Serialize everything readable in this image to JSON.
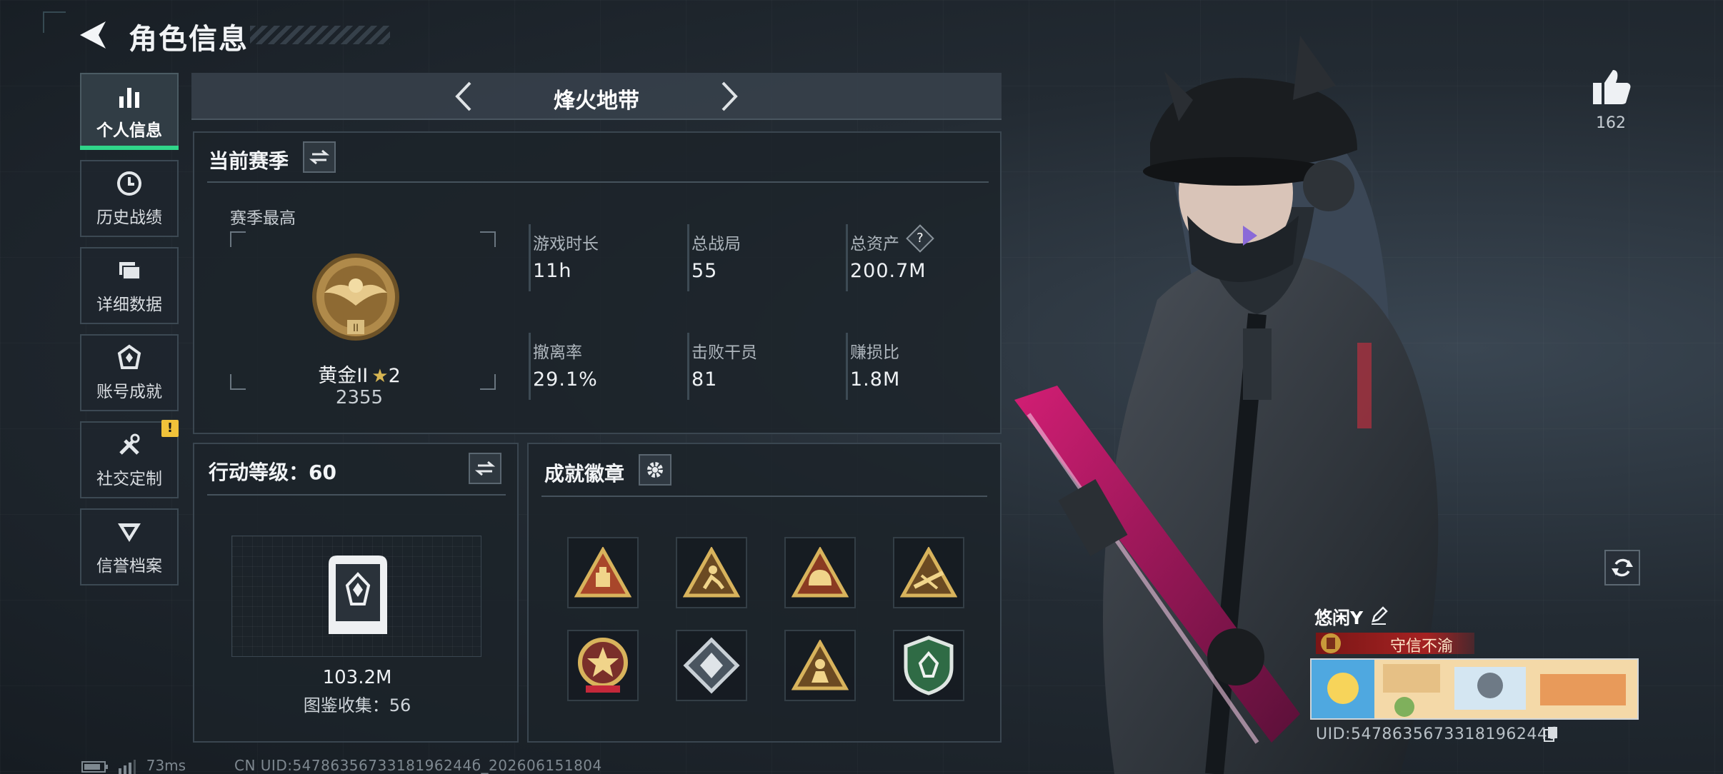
{
  "header": {
    "title": "角色信息"
  },
  "sidebar": {
    "items": [
      {
        "label": "个人信息",
        "icon": "bar-chart-icon",
        "active": true
      },
      {
        "label": "历史战绩",
        "icon": "history-clock-icon"
      },
      {
        "label": "详细数据",
        "icon": "folder-icon"
      },
      {
        "label": "账号成就",
        "icon": "achievement-icon"
      },
      {
        "label": "社交定制",
        "icon": "tools-icon",
        "alert": "!"
      },
      {
        "label": "信誉档案",
        "icon": "reputation-icon"
      }
    ]
  },
  "mode": {
    "title": "烽火地带"
  },
  "season": {
    "title": "当前赛季",
    "peak_label": "赛季最高",
    "rank_name": "黄金II",
    "rank_stars": "2",
    "rank_score": "2355",
    "stats": [
      {
        "label": "游戏时长",
        "value": "11h"
      },
      {
        "label": "总战局",
        "value": "55"
      },
      {
        "label": "总资产",
        "value": "200.7M",
        "help": "?"
      },
      {
        "label": "撤离率",
        "value": "29.1%"
      },
      {
        "label": "击败干员",
        "value": "81"
      },
      {
        "label": "赚损比",
        "value": "1.8M"
      }
    ]
  },
  "action_level": {
    "title": "行动等级：60",
    "value": "103.2M",
    "collection": "图鉴收集：56"
  },
  "achievements": {
    "title": "成就徽章",
    "badges": [
      {
        "icon": "triangle-badge-weight-icon"
      },
      {
        "icon": "triangle-badge-runner-icon"
      },
      {
        "icon": "triangle-badge-helmet-icon"
      },
      {
        "icon": "triangle-badge-rifle-icon"
      },
      {
        "icon": "round-star-medal-icon"
      },
      {
        "icon": "diamond-wolf-badge-icon"
      },
      {
        "icon": "triangle-badge-soldier-icon"
      },
      {
        "icon": "green-shield-badge-icon"
      }
    ]
  },
  "profile": {
    "likes": "162",
    "name": "悠闲Y",
    "title": "守信不渝",
    "uid": "UID:5478635673318196244б"
  },
  "footer": {
    "ping": "73ms",
    "uid_line": "CN UID:5478635673318196244б_202606151804"
  },
  "colors": {
    "accent_green": "#30d68a",
    "alert_yellow": "#f0c23a",
    "title_red": "#a52222"
  }
}
